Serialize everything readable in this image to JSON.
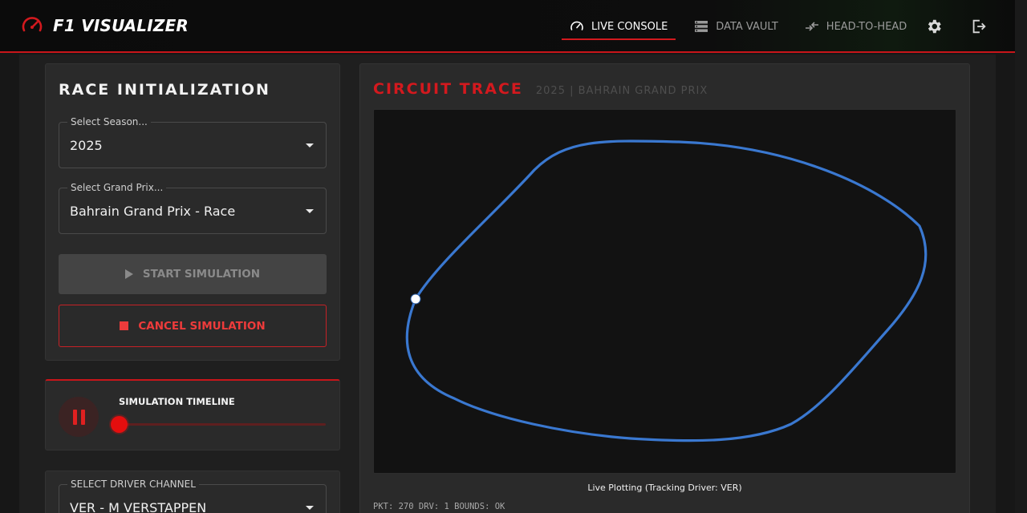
{
  "app": {
    "title": "F1 VISUALIZER",
    "accent_color": "#d3191e"
  },
  "nav": {
    "items": [
      {
        "label": "LIVE CONSOLE",
        "icon": "speedometer-icon",
        "active": true
      },
      {
        "label": "DATA VAULT",
        "icon": "storage-icon",
        "active": false
      },
      {
        "label": "HEAD-TO-HEAD",
        "icon": "compare-arrows-icon",
        "active": false
      }
    ],
    "settings_icon": "gear-icon",
    "logout_icon": "logout-icon"
  },
  "race_init": {
    "title": "RACE INITIALIZATION",
    "season": {
      "label": "Select Season...",
      "value": "2025"
    },
    "grand_prix": {
      "label": "Select Grand Prix...",
      "value": "Bahrain Grand Prix - Race"
    },
    "start_label": "START SIMULATION",
    "cancel_label": "CANCEL SIMULATION"
  },
  "timeline": {
    "label": "SIMULATION TIMELINE",
    "progress": 0.0,
    "state": "playing"
  },
  "driver_channel": {
    "label": "SELECT DRIVER CHANNEL",
    "value": "VER - M VERSTAPPEN"
  },
  "circuit": {
    "title": "CIRCUIT TRACE",
    "subtitle": "2025 | BAHRAIN GRAND PRIX",
    "trace_color": "#3a78d0",
    "caption": "Live Plotting (Tracking Driver: VER)",
    "status_line": "PKT: 270 DRV: 1 BOUNDS: OK"
  }
}
